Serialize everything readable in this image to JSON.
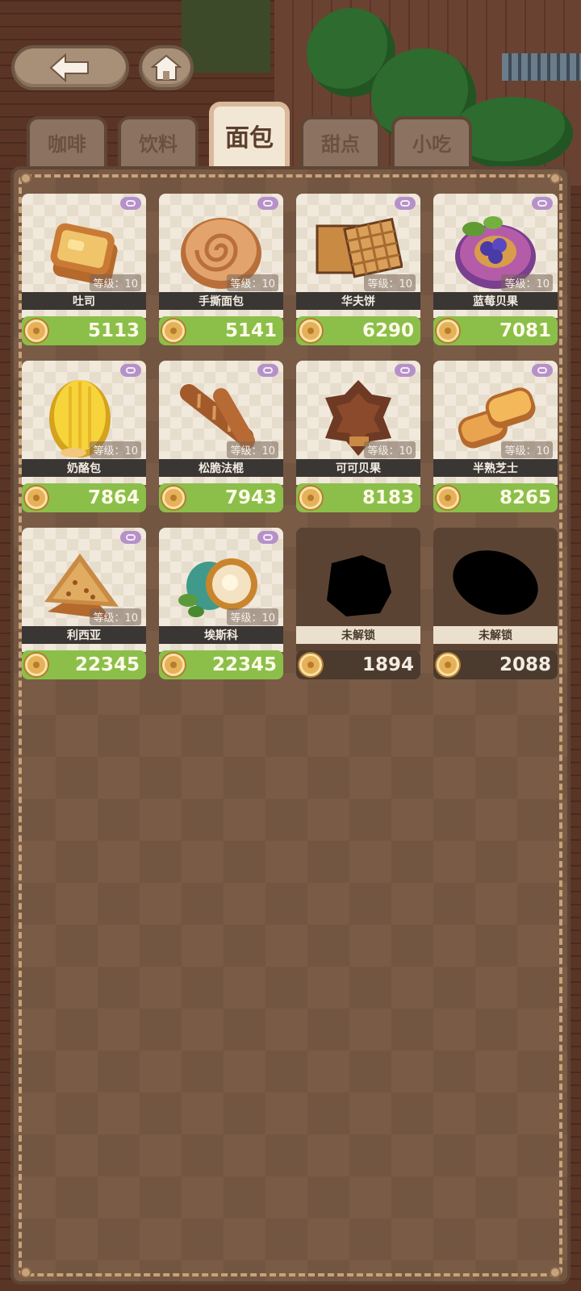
{
  "tabs": [
    {
      "label": "咖啡",
      "active": false
    },
    {
      "label": "饮料",
      "active": false
    },
    {
      "label": "面包",
      "active": true
    },
    {
      "label": "甜点",
      "active": false
    },
    {
      "label": "小吃",
      "active": false
    }
  ],
  "items": [
    {
      "name": "吐司",
      "level": "等级：10",
      "price": "5113",
      "icon": "toast-icon"
    },
    {
      "name": "手撕面包",
      "level": "等级：10",
      "price": "5141",
      "icon": "swirl-bread-icon"
    },
    {
      "name": "华夫饼",
      "level": "等级：10",
      "price": "6290",
      "icon": "waffle-icon"
    },
    {
      "name": "蓝莓贝果",
      "level": "等级：10",
      "price": "7081",
      "icon": "blueberry-bagel-icon"
    },
    {
      "name": "奶酪包",
      "level": "等级：10",
      "price": "7864",
      "icon": "cheese-bun-icon"
    },
    {
      "name": "松脆法棍",
      "level": "等级：10",
      "price": "7943",
      "icon": "baguette-icon"
    },
    {
      "name": "可可贝果",
      "level": "等级：10",
      "price": "8183",
      "icon": "cocoa-bagel-icon"
    },
    {
      "name": "半熟芝士",
      "level": "等级：10",
      "price": "8265",
      "icon": "half-baked-cheese-icon"
    },
    {
      "name": "利西亚",
      "level": "等级：10",
      "price": "22345",
      "icon": "sandwich-icon"
    },
    {
      "name": "埃斯科",
      "level": "等级：10",
      "price": "22345",
      "icon": "escargot-bread-icon"
    },
    {
      "name": "未解锁",
      "level": "",
      "price": "1894",
      "icon": "locked-silhouette-icon",
      "locked": true
    },
    {
      "name": "未解锁",
      "level": "",
      "price": "2088",
      "icon": "locked-silhouette-icon",
      "locked": true
    }
  ],
  "colors": {
    "panel": "#7a5b45",
    "price_unlocked": "#8bbf4a",
    "price_locked": "#4b3a2e",
    "tab_active": "#f2e7d5"
  }
}
